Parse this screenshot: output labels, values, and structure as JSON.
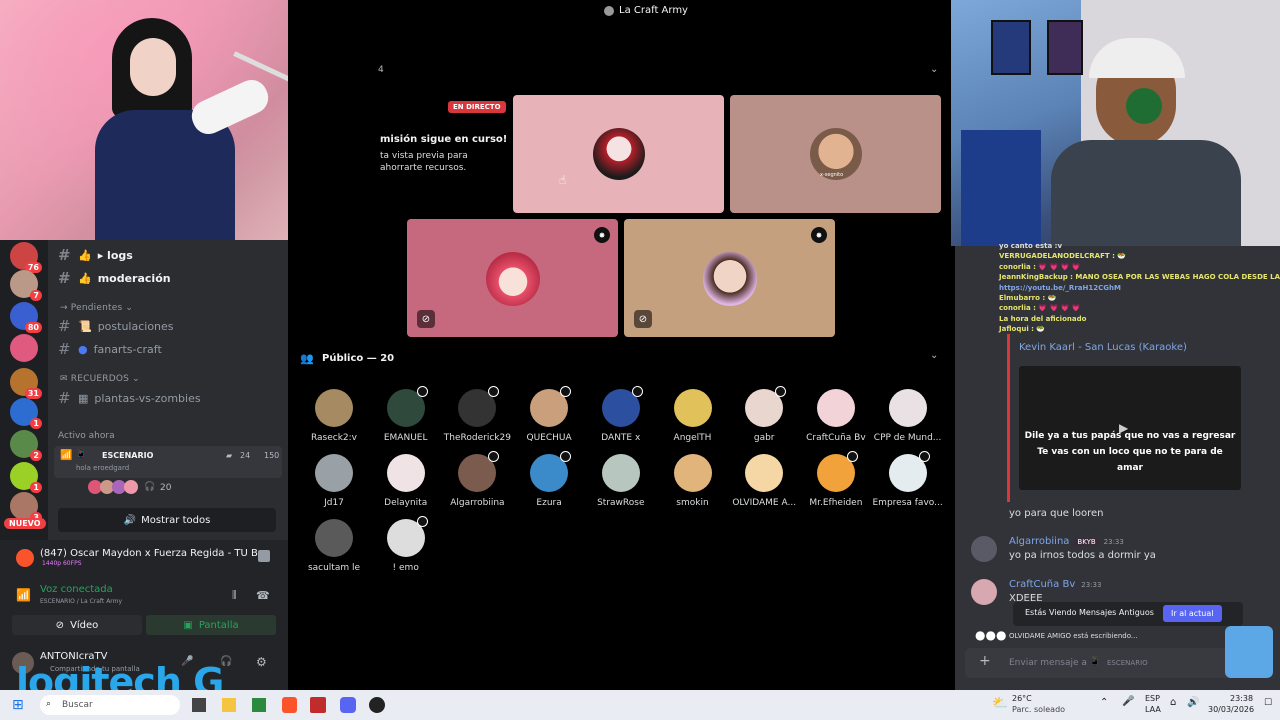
{
  "window": {
    "title": "La Craft Army"
  },
  "server_rail": {
    "badges": [
      "76",
      "7",
      "80",
      "31",
      "1",
      "2",
      "1",
      "3"
    ],
    "new_label": "NUEVO"
  },
  "channels": [
    {
      "name": "▸ logs",
      "highlight": true
    },
    {
      "name": "moderación",
      "highlight": true
    }
  ],
  "category_pendientes": "→ Pendientes ⌄",
  "pending_channels": [
    "postulaciones",
    "fanarts-craft"
  ],
  "category_recuerdos": "✉ RECUERDOS ⌄",
  "recuerdos_channels": [
    "plantas-vs-zombies"
  ],
  "activo": {
    "label": "Activo ahora",
    "stage_label": "ESCENARIO",
    "stage_sub": "hola eroedgard",
    "viewers": "24",
    "count": "150",
    "listeners": "20",
    "show_all": "Mostrar todos"
  },
  "now_playing": {
    "title": "(847) Oscar Maydon x Fuerza Regida - TU B...",
    "quality": "1440p 60FPS"
  },
  "voice": {
    "status": "Voz conectada",
    "location": "ESCENARIO / La Craft Army",
    "video_btn": "Vídeo",
    "screen_btn": "Pantalla"
  },
  "user": {
    "name": "ANTONIcraTV",
    "status": "Compartiendo tu pantalla"
  },
  "stage": {
    "count_label": "4",
    "live_badge": "EN DIRECTO",
    "preview_title": "misión sigue en curso!",
    "preview_text": "ta vista previa para ahorrarte recursos.",
    "small_label": "x-segnito",
    "public_label": "Público — 20"
  },
  "audience": [
    "Raseck2:v",
    "EMANUEL",
    "TheRoderick29",
    "QUECHUA",
    "DANTE x",
    "AngelTH",
    "gabr",
    "CraftCuña Bv",
    "CPP de Mund...",
    "Jd17",
    "Delaynita",
    "Algarrobiina",
    "Ezura",
    "StrawRose",
    "smokin",
    "OLVIDAME A...",
    "Mr.Efheiden",
    "Empresa favo...",
    "sacultam le",
    "! emo"
  ],
  "chat": {
    "scroll_lines": [
      {
        "text": "yo canto esta :v",
        "color": "#dbdee1"
      },
      {
        "text": "VERRUGADELANODELCRAFT : 🥗",
        "color": "#e6e66e"
      },
      {
        "text": "conorlia : 💗 💗 💗 💗",
        "color": "#e6e66e"
      },
      {
        "text": "JeannKingBackup : MANO OSEA POR LAS WEBAS HAGO COLA DESDE LAS 6 AM",
        "color": "#e6e66e"
      },
      {
        "text": "https://youtu.be/_RraH12CGhM",
        "color": "#7fa6e6"
      },
      {
        "text": "Elmubarro : 🥗",
        "color": "#e6e66e"
      },
      {
        "text": "conorlia : 💗 💗 💗 💗",
        "color": "#e6e66e"
      },
      {
        "text": "La hora del aficionado",
        "color": "#e6e66e"
      },
      {
        "text": "Jafloqui : 🥗",
        "color": "#e6e66e"
      }
    ],
    "embed_title": "Kevin Kaarl - San Lucas (Karaoke)",
    "lyric_lines": [
      "Dile ya a tus papás que no vas a regresar",
      "Te vas con un loco que no te para de",
      "amar"
    ],
    "messages": [
      {
        "user": "",
        "text": "yo para que looren"
      },
      {
        "user": "Algarrobiina",
        "tag": "BKYB",
        "time": "23:33",
        "text": "yo pa irnos todos a dormir ya"
      },
      {
        "user": "CraftCuña Bv",
        "time": "23:33",
        "text": "XDEEE"
      }
    ],
    "old_msgs": "Estás Viendo Mensajes Antiguos",
    "jump": "Ir al actual",
    "typing": "OLVIDAME AMIGO está escribiendo...",
    "input_placeholder": "Enviar mensaje a",
    "input_channel": "ESCENARIO"
  },
  "taskbar": {
    "search": "Buscar",
    "weather_temp": "26°C",
    "weather_text": "Parc. soleado",
    "lang1": "ESP",
    "lang2": "LAA",
    "time": "23:38",
    "date": "30/03/2026"
  },
  "overlay": {
    "logo": "logitech G"
  }
}
